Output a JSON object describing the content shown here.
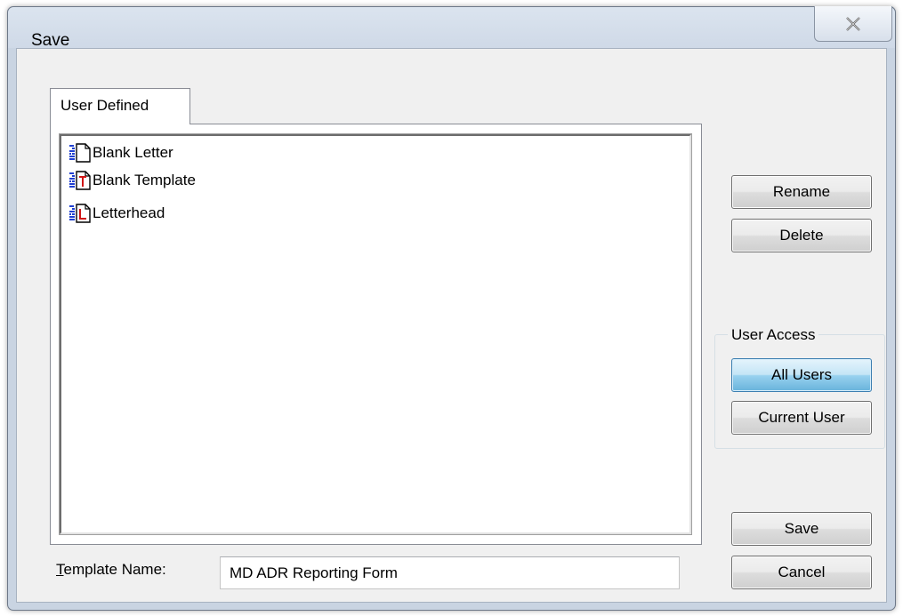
{
  "window": {
    "title": "Save",
    "close_icon": "close-icon"
  },
  "tabs": [
    {
      "label": "User Defined",
      "selected": true
    }
  ],
  "templates": [
    {
      "label": "Blank Letter",
      "icon": "blank-letter-doc-icon"
    },
    {
      "label": "Blank Template",
      "icon": "template-doc-icon"
    },
    {
      "label": "Letterhead",
      "icon": "letterhead-doc-icon"
    }
  ],
  "actions": {
    "rename_label": "Rename",
    "delete_label": "Delete"
  },
  "user_access": {
    "group_label": "User Access",
    "all_users_label": "All Users",
    "current_user_label": "Current User",
    "selected": "All Users"
  },
  "footer": {
    "template_name_label_mnemonic": "T",
    "template_name_label_rest": "emplate Name:",
    "template_name_value": "MD ADR Reporting Form",
    "save_label": "Save",
    "cancel_label": "Cancel"
  },
  "colors": {
    "accent_selected_button": "#98d1ef",
    "icon_letter_red": "#d01515",
    "icon_lines_blue": "#1f3fd0"
  }
}
